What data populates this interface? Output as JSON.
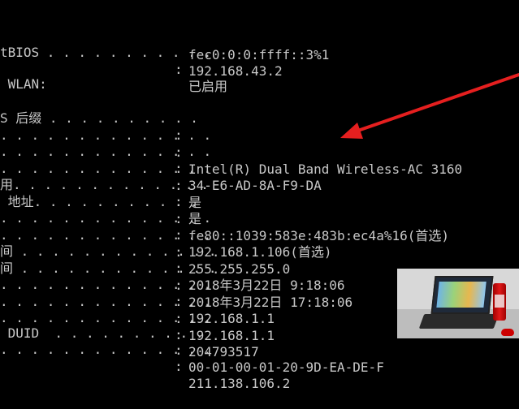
{
  "terminal": {
    "lines": [
      {
        "label": "",
        "colon": "",
        "value": "fec0:0:0:ffff::3%1"
      },
      {
        "label": "",
        "colon": "",
        "value": "192.168.43.2"
      },
      {
        "label": "tBIOS . . . . . . . . . . .",
        "colon": ":",
        "value": "已启用"
      },
      {
        "label": "",
        "colon": "",
        "value": ""
      },
      {
        "label": " WLAN:",
        "colon": "",
        "value": ""
      },
      {
        "label": "",
        "colon": "",
        "value": ""
      },
      {
        "label": "S 后缀 . . . . . . . . . .",
        "colon": ":",
        "value": ""
      },
      {
        "label": ". . . . . . . . . . . . . .",
        "colon": ":",
        "value": "Intel(R) Dual Band Wireless-AC 3160"
      },
      {
        "label": ". . . . . . . . . . . . . .",
        "colon": ":",
        "value": "34-E6-AD-8A-F9-DA"
      },
      {
        "label": ". . . . . . . . . . . . . .",
        "colon": ":",
        "value": "是"
      },
      {
        "label": "用. . . . . . . . . . . . .",
        "colon": ":",
        "value": "是"
      },
      {
        "label": " 地址. . . . . . . . . . .",
        "colon": ":",
        "value": "fe80::1039:583e:483b:ec4a%16(首选)"
      },
      {
        "label": ". . . . . . . . . . . . . .",
        "colon": ":",
        "value": "192.168.1.106(首选)"
      },
      {
        "label": ". . . . . . . . . . . . . .",
        "colon": ":",
        "value": "255.255.255.0"
      },
      {
        "label": "间 . . . . . . . . . . . . .",
        "colon": ":",
        "value": "2018年3月22日 9:18:06"
      },
      {
        "label": "间 . . . . . . . . . . . . .",
        "colon": ":",
        "value": "2018年3月22日 17:18:06"
      },
      {
        "label": ". . . . . . . . . . . . . .",
        "colon": ":",
        "value": "192.168.1.1"
      },
      {
        "label": ". . . . . . . . . . . . . .",
        "colon": ":",
        "value": "192.168.1.1"
      },
      {
        "label": ". . . . . . . . . . . . . .",
        "colon": ":",
        "value": "204793517"
      },
      {
        "label": " DUID  . . . . . . . . . .",
        "colon": ":",
        "value": "00-01-00-01-20-9D-EA-DE-F"
      },
      {
        "label": ". . . . . . . . . . . . . .",
        "colon": ":",
        "value": "211.138.106.2"
      }
    ]
  },
  "colors": {
    "background": "#000000",
    "text": "#c8c8c8",
    "arrow": "#e51f1f"
  },
  "overlay": {
    "thumbnail_icon": "laptop-photo",
    "arrow_icon": "red-arrow-icon"
  }
}
